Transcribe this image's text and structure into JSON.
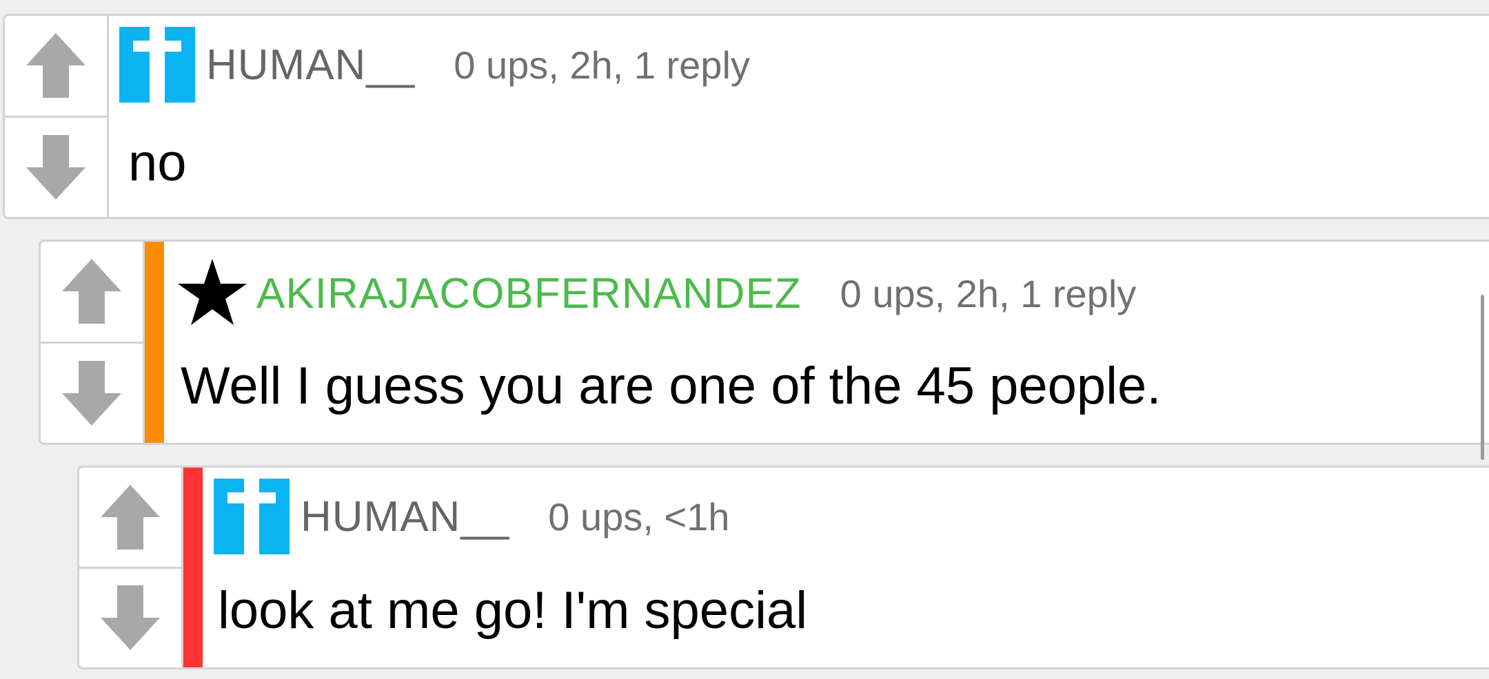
{
  "comments": [
    {
      "username": "HUMAN__",
      "avatar_icon": "blue-quote-pixel-avatar",
      "meta": "0 ups, 2h, 1 reply",
      "body": "no",
      "depth_color": null
    },
    {
      "username": "AKIRAJACOBFERNANDEZ",
      "avatar_icon": "star-icon",
      "username_color": "#4cba4c",
      "meta": "0 ups, 2h, 1 reply",
      "body": "Well I guess you are one of the 45 people.",
      "depth_color": "#ff8c00"
    },
    {
      "username": "HUMAN__",
      "avatar_icon": "blue-quote-pixel-avatar",
      "meta": "0 ups, <1h",
      "body": "look at me go! I'm special",
      "depth_color": "#ff3333"
    }
  ],
  "colors": {
    "avatar_blue": "#0ab4f0",
    "vote_arrow": "#a8a8a8",
    "border": "#d3d3d3"
  }
}
